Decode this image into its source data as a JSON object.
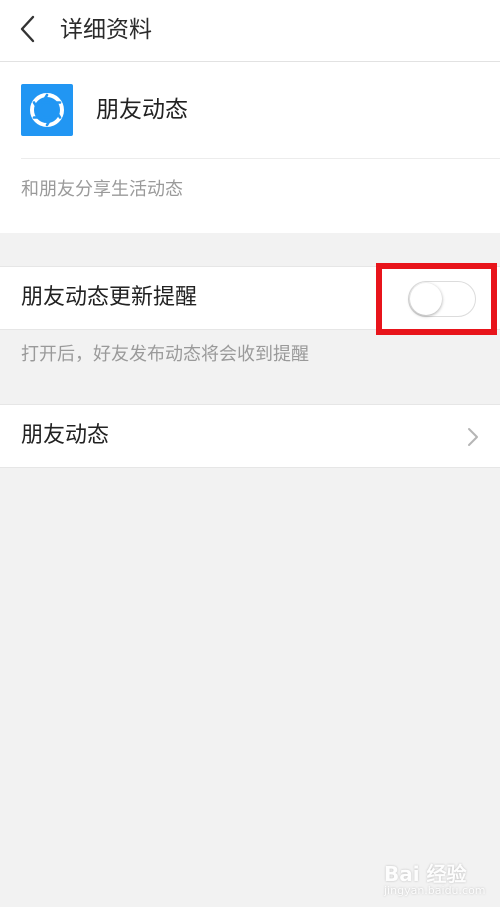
{
  "nav": {
    "title": "详细资料",
    "back_icon": "chevron-left-icon"
  },
  "app": {
    "name": "朋友动态",
    "icon": "camera-aperture-icon",
    "description": "和朋友分享生活动态",
    "icon_color": "#2196f3"
  },
  "settings": {
    "update_reminder": {
      "label": "朋友动态更新提醒",
      "enabled": false,
      "hint": "打开后，好友发布动态将会收到提醒"
    },
    "moments_link": {
      "label": "朋友动态",
      "chevron": "chevron-right-icon"
    }
  },
  "annotation": {
    "color": "#e8141b"
  },
  "watermark": {
    "text": "Bai 经验",
    "url": "jingyan.baidu.com"
  }
}
